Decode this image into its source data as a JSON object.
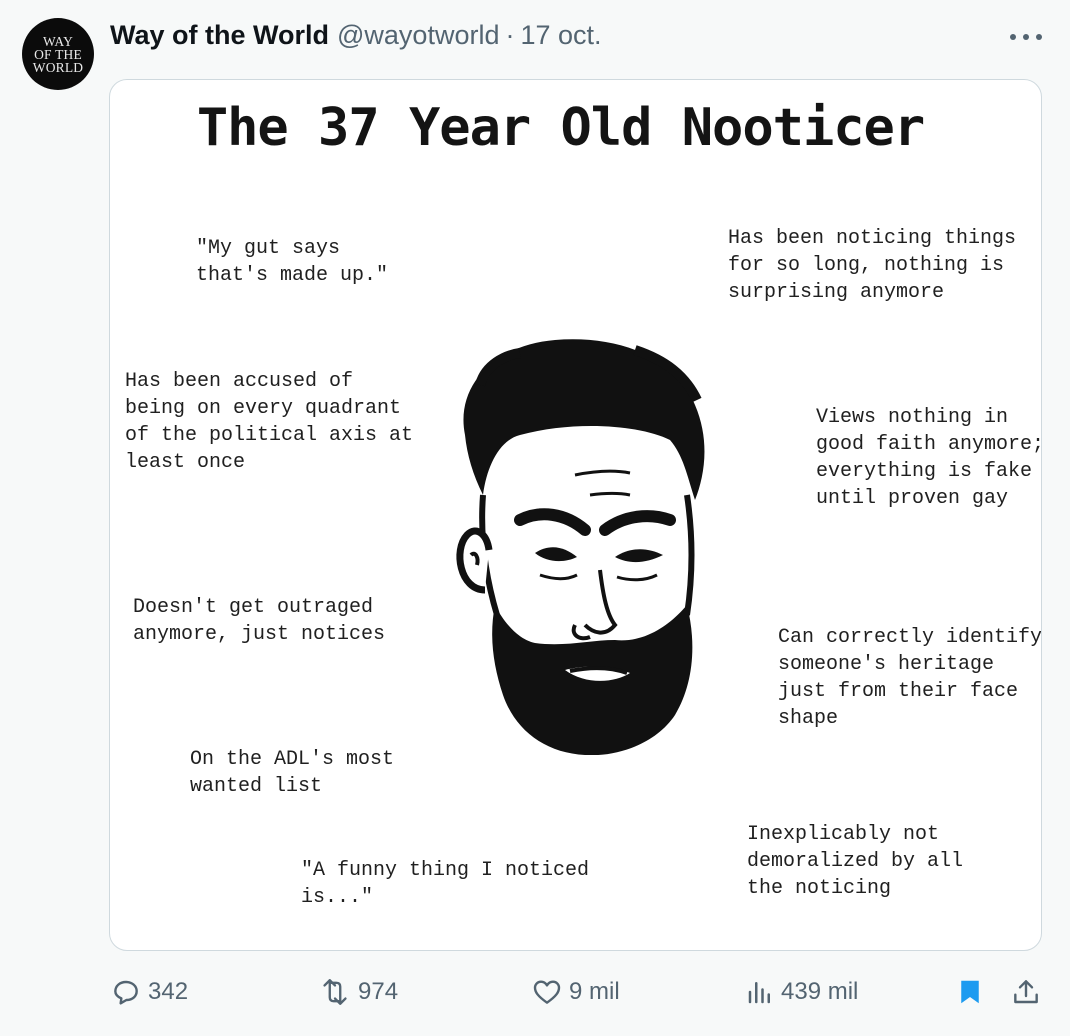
{
  "tweet": {
    "avatar_lines": [
      "WAY",
      "OF THE",
      "WORLD"
    ],
    "display_name": "Way of the World",
    "handle": "@wayotworld",
    "separator": "·",
    "date": "17 oct.",
    "more_icon": "more-horizontal-icon"
  },
  "meme": {
    "title": "The 37 Year Old Nooticer",
    "captions": {
      "gut": "\"My gut says\nthat's made up.\"",
      "noticing_long": "Has been noticing things\nfor so long, nothing is\nsurprising anymore",
      "quadrant": "Has been accused of\nbeing on every quadrant\nof the political axis at\nleast once",
      "good_faith": "Views nothing in\ngood faith anymore;\neverything is fake\nuntil proven gay",
      "outraged": "Doesn't get outraged\nanymore, just notices",
      "heritage": "Can correctly identify\nsomeone's heritage\njust from their face\nshape",
      "adl": "On the ADL's most\nwanted list",
      "demoralized": "Inexplicably not\ndemoralized by all\nthe noticing",
      "funny": "\"A funny thing I noticed\nis...\""
    }
  },
  "actions": {
    "replies": "342",
    "reposts": "974",
    "likes": "9 mil",
    "views": "439 mil",
    "bookmark_color": "#1d9bf0",
    "icons": [
      "reply-icon",
      "repost-icon",
      "like-icon",
      "views-icon",
      "bookmark-icon",
      "share-icon"
    ]
  }
}
